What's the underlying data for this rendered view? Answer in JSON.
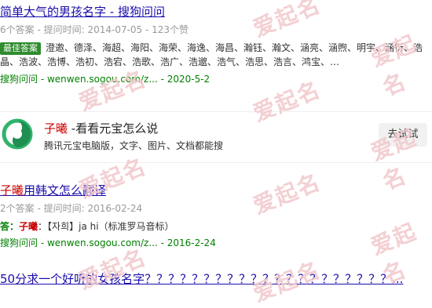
{
  "results": [
    {
      "title": "简单大气的男孩名字 - 搜狗问问",
      "meta": "6个答案 - 提问时间: 2014-07-05 - 123个赞",
      "badge": "最佳答案",
      "best_text": "澄邀、德泽、海超、海阳、海荣、海逸、海昌、瀚钰、瀚文、涵亮、涵煦、明宇、涵衍、浩晶、浩波、浩博、浩初、浩宕、浩歌、浩广、浩邈、浩气、浩思、浩言、鸿宝、…",
      "source": "搜狗问问 - wenwen.sogou.com/z... - 2020-5-2"
    },
    {
      "title_highlight": "子曦",
      "title_rest": "用韩文怎么翻译",
      "meta": "2个答案 - 提问时间: 2016-02-24",
      "answer_label": "答：",
      "answer_highlight": "子曦",
      "answer_text": "：【자희】ja hi（标准罗马音标）",
      "source": "搜狗问问 - wenwen.sogou.com/z... - 2016-2-24"
    },
    {
      "title": "50分求一个好听的女孩名字？？？？？？？？？？？？？？？？？？？？？..."
    }
  ],
  "ad": {
    "title_highlight": "子曦",
    "title_rest": " -看看元宝怎么说",
    "desc": "腾讯元宝电脑版，文字、图片、文档都能搜",
    "button": "去试试",
    "logo_icon": "yuanbao-logo-icon"
  },
  "watermark": "爱起名",
  "colors": {
    "link": "#1a0dab",
    "highlight": "#c00000",
    "source": "#008000",
    "badge": "#2e8b2e",
    "watermark": "#f2c8cc"
  }
}
